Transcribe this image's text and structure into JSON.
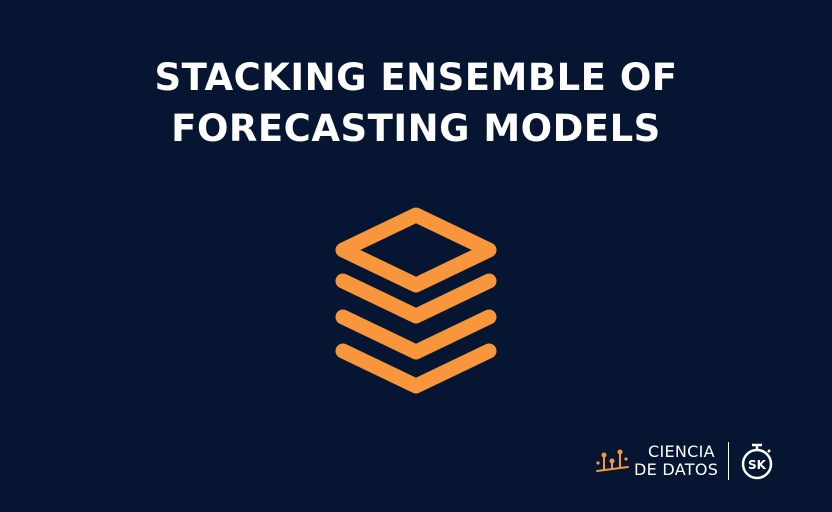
{
  "title": {
    "line1": "STACKING ENSEMBLE OF",
    "line2": "FORECASTING MODELS"
  },
  "icon": {
    "name": "stacked-layers-icon",
    "color": "#F7963A"
  },
  "background_color": "#061632",
  "branding": {
    "logo_line1": "CIENCIA",
    "logo_line2": "DE DATOS",
    "secondary_logo_text": "SK",
    "accent_color": "#F7963A"
  }
}
